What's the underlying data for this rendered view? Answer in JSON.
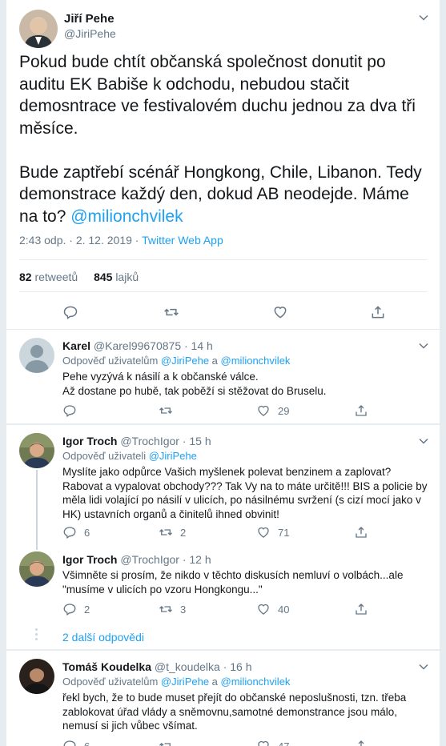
{
  "main_tweet": {
    "author_name": "Jiří Pehe",
    "author_handle": "@JiriPehe",
    "text_part1": "Pokud bude chtít občanská společnost donutit po auditu EK Babiše k odchodu, nebudou stačit demosntrace ve festivalovém duchu jednou za dva tři měsíce.\n\nBude zaptřebí scénář Hongkong, Chile, Libanon. Tedy demonstrace každý den, dokud AB neodejde. Máme na to? ",
    "text_mention": "@milionchvilek",
    "timestamp": "2:43 odp. · 2. 12. 2019 · ",
    "source": "Twitter Web App",
    "retweets_count": "82",
    "retweets_label": "retweetů",
    "likes_count": "845",
    "likes_label": "lajků"
  },
  "replies": [
    {
      "name": "Karel",
      "handle": "@Karel99670875",
      "time": " · 14 h",
      "reply_prefix": "Odpověď uživatelům ",
      "reply_to_1": "@JiriPehe",
      "reply_join": " a ",
      "reply_to_2": "@milionchvilek",
      "text": "Pehe vyzývá k násilí a k občanské válce.\nAž dostane po hubě, tak poběží si stěžovat do Bruselu.",
      "replies": "",
      "retweets": "",
      "likes": "29"
    },
    {
      "name": "Igor Troch",
      "handle": "@TrochIgor",
      "time": " · 15 h",
      "reply_prefix": "Odpověď uživateli ",
      "reply_to_1": "@JiriPehe",
      "text": "Myslíte jako odpůrce Vašich myšlenek polevat benzinem a zaplovat? Rabovat a vypalovat obchody??? Tak Vy na to máte určitě!!! BIS a policie by měla lidi volající po násilí v ulicích, po násilnému svržení (s cizí mocí jako v HK) ustavních organů a činitelů ihned obvinit!",
      "replies": "6",
      "retweets": "2",
      "likes": "71"
    },
    {
      "name": "Igor Troch",
      "handle": "@TrochIgor",
      "time": " · 12 h",
      "text": "Všimněte si prosím, že nikdo v těchto diskusích nemluví o volbách...ale \"musíme v ulicích po vzoru Hongkongu...\"",
      "replies": "2",
      "retweets": "3",
      "likes": "40",
      "more_label": "2 další odpovědi"
    },
    {
      "name": "Tomáš Koudelka",
      "handle": "@t_koudelka",
      "time": " · 16 h",
      "reply_prefix": "Odpověď uživatelům ",
      "reply_to_1": "@JiriPehe",
      "reply_join": " a ",
      "reply_to_2": "@milionchvilek",
      "text": "řekl bych, že to bude muset přejít do občanské neposlušnosti, tzn. třeba zablokovat úřad vlády a sněmovnu,samotné demonstrance jsou málo, nemusí si jich vůbec všímat.",
      "replies": "6",
      "retweets": "",
      "likes": "47"
    }
  ],
  "colors": {
    "accent": "#1da1f2",
    "muted": "#657786",
    "bg": "#e6ecf0"
  },
  "icons": [
    "reply-icon",
    "retweet-icon",
    "like-icon",
    "share-icon",
    "chevron-down-icon"
  ]
}
